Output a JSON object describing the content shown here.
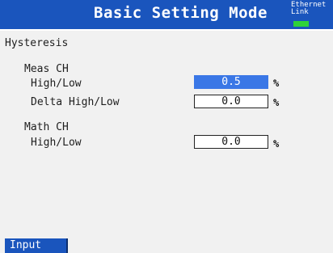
{
  "header": {
    "title": "Basic Setting Mode",
    "ethernet_label": "Ethernet",
    "link_label": "Link",
    "link_indicator_color": "#2ed23a"
  },
  "section": {
    "title": "Hysteresis",
    "meas_ch": {
      "label": "Meas CH",
      "rows": [
        {
          "label": "High/Low",
          "value": "0.5",
          "unit": "%",
          "selected": true
        },
        {
          "label": "Delta High/Low",
          "value": "0.0",
          "unit": "%",
          "selected": false
        }
      ]
    },
    "math_ch": {
      "label": "Math CH",
      "rows": [
        {
          "label": "High/Low",
          "value": "0.0",
          "unit": "%",
          "selected": false
        }
      ]
    }
  },
  "softkeys": {
    "input_label": "Input"
  },
  "colors": {
    "header_bg": "#1a55bd",
    "selected_field": "#3a77e6",
    "background": "#f1f1f1"
  }
}
